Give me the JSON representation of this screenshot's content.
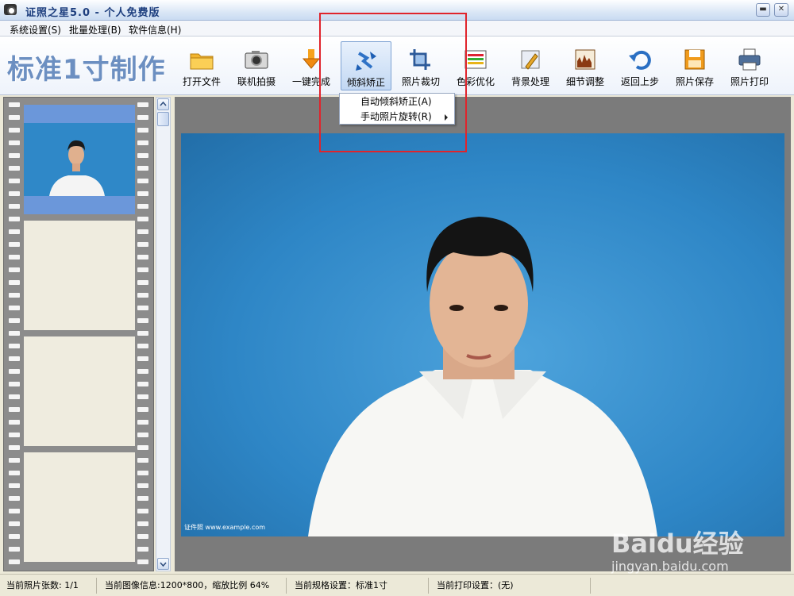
{
  "window": {
    "title": "证照之星5.0 - 个人免费版",
    "minimize": "▬",
    "close": "✕"
  },
  "menu": [
    {
      "label": "系统设置(S)"
    },
    {
      "label": "批量处理(B)"
    },
    {
      "label": "软件信息(H)"
    }
  ],
  "logo": {
    "text": "标准1寸制作"
  },
  "toolbar": [
    {
      "label": "打开文件",
      "icon": "folder-icon"
    },
    {
      "label": "联机拍摄",
      "icon": "camera-icon"
    },
    {
      "label": "一键完成",
      "icon": "one-click-icon"
    },
    {
      "label": "倾斜矫正",
      "icon": "rotate-correct-icon",
      "active": true
    },
    {
      "label": "照片裁切",
      "icon": "crop-icon"
    },
    {
      "label": "色彩优化",
      "icon": "color-icon"
    },
    {
      "label": "背景处理",
      "icon": "background-icon"
    },
    {
      "label": "细节调整",
      "icon": "detail-icon"
    },
    {
      "label": "返回上步",
      "icon": "undo-icon"
    },
    {
      "label": "照片保存",
      "icon": "save-icon"
    },
    {
      "label": "照片打印",
      "icon": "print-icon"
    }
  ],
  "dropdown": [
    {
      "label": "自动倾斜矫正(A)"
    },
    {
      "label": "手动照片旋转(R)",
      "has_submenu": true
    }
  ],
  "photo": {
    "stamp": "证件照 www.example.com"
  },
  "status": [
    {
      "label": "当前照片张数: 1/1"
    },
    {
      "label": "当前图像信息:1200*800，缩放比例 64%"
    },
    {
      "label": "当前规格设置：标准1寸"
    },
    {
      "label": "当前打印设置：(无)"
    }
  ],
  "watermark": {
    "brand": "Baidu经验",
    "url": "jingyan.baidu.com"
  },
  "colors": {
    "accent": "#6c8fc1",
    "photo_bg": "#2e86c6",
    "highlight": "#e0242c",
    "frame_selected": "#6b97da"
  }
}
